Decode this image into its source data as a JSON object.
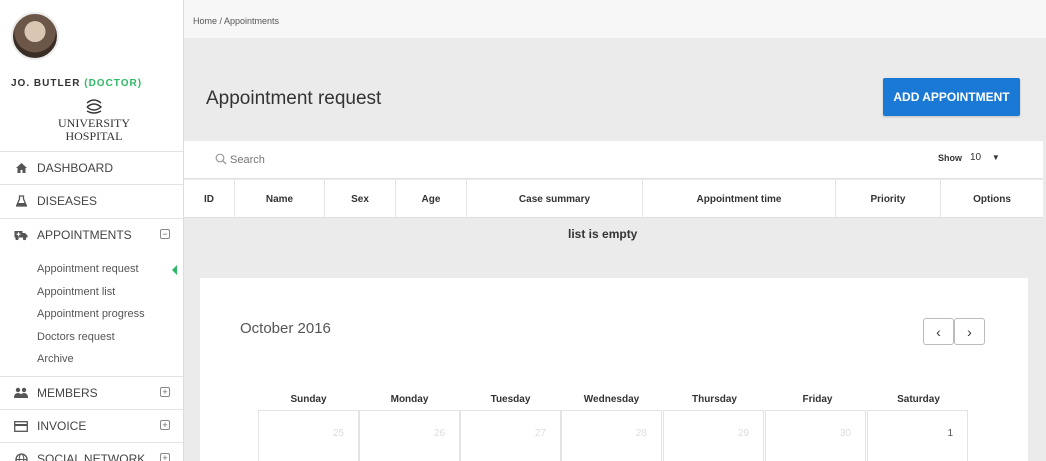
{
  "user": {
    "name": "JO. BUTLER",
    "role": "(DOCTOR)"
  },
  "logo": {
    "line1": "UNIVERSITY",
    "line2": "HOSPITAL"
  },
  "sidebar": {
    "items": [
      {
        "label": "DASHBOARD",
        "icon": "home-icon"
      },
      {
        "label": "DISEASES",
        "icon": "flask-icon"
      },
      {
        "label": "APPOINTMENTS",
        "icon": "ambulance-icon",
        "expand": "⊟"
      },
      {
        "label": "MEMBERS",
        "icon": "users-icon",
        "expand": "⊞"
      },
      {
        "label": "INVOICE",
        "icon": "card-icon",
        "expand": "⊞"
      },
      {
        "label": "SOCIAL NETWORK",
        "icon": "globe-icon",
        "expand": "⊞"
      }
    ],
    "submenu": [
      "Appointment request",
      "Appointment list",
      "Appointment progress",
      "Doctors request",
      "Archive"
    ]
  },
  "breadcrumb": "Home  /  Appointments",
  "page": {
    "title": "Appointment request",
    "add_button": "ADD APPOINTMENT"
  },
  "search": {
    "placeholder": "Search"
  },
  "show": {
    "label": "Show",
    "value": "10",
    "caret": "▼"
  },
  "table": {
    "columns": [
      "ID",
      "Name",
      "Sex",
      "Age",
      "Case summary",
      "Appointment time",
      "Priority",
      "Options"
    ],
    "empty": "list is empty"
  },
  "calendar": {
    "title": "October  2016",
    "prev": "‹",
    "next": "›",
    "weekdays": [
      "Sunday",
      "Monday",
      "Tuesday",
      "Wednesday",
      "Thursday",
      "Friday",
      "Saturday"
    ],
    "days": [
      "25",
      "26",
      "27",
      "28",
      "29",
      "30",
      "1"
    ]
  },
  "colors": {
    "accent": "#1b79d6",
    "role": "#2fb866"
  }
}
